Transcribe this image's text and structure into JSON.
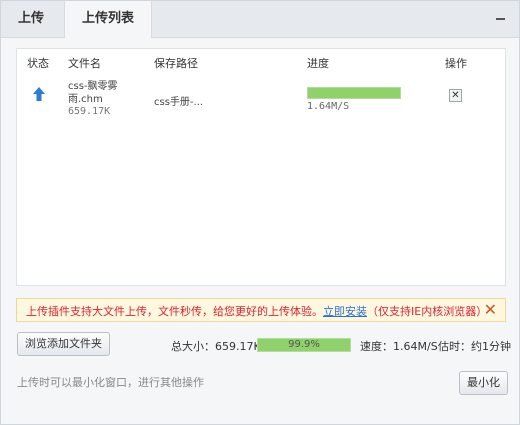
{
  "tabs": {
    "upload": "上传",
    "upload_list": "上传列表"
  },
  "table": {
    "headers": {
      "status": "状态",
      "filename": "文件名",
      "save_path": "保存路径",
      "progress": "进度",
      "action": "操作"
    },
    "rows": [
      {
        "filename": "css-飘零雾雨.chm",
        "size": "659.17K",
        "save_path": "css手册-...",
        "progress": 1.0,
        "speed": "1.64M/S",
        "delete_glyph": "✕"
      }
    ]
  },
  "notice": {
    "text_before": "上传插件支持大文件上传，文件秒传，给您更好的上传体验。",
    "link": "立即安装",
    "text_after": "（仅支持IE内核浏览器）",
    "close_glyph": "✕"
  },
  "footer": {
    "browse_button": "浏览添加文件夹",
    "total_size": "总大小：659.17K",
    "total_progress_text": "99.9%",
    "total_progress": 0.999,
    "speed": "速度：1.64M/S",
    "eta": "估时：约1分钟",
    "hint": "上传时可以最小化窗口，进行其他操作",
    "minimize_button": "最小化"
  },
  "colors": {
    "progress_fill": "#8fd16a",
    "notice_text": "#dd2233",
    "link": "#2a6fd6",
    "arrow": "#2a7fd4"
  },
  "icons": {
    "status": "upload-arrow-icon",
    "delete": "close-icon",
    "window_minimize": "minus-icon"
  }
}
